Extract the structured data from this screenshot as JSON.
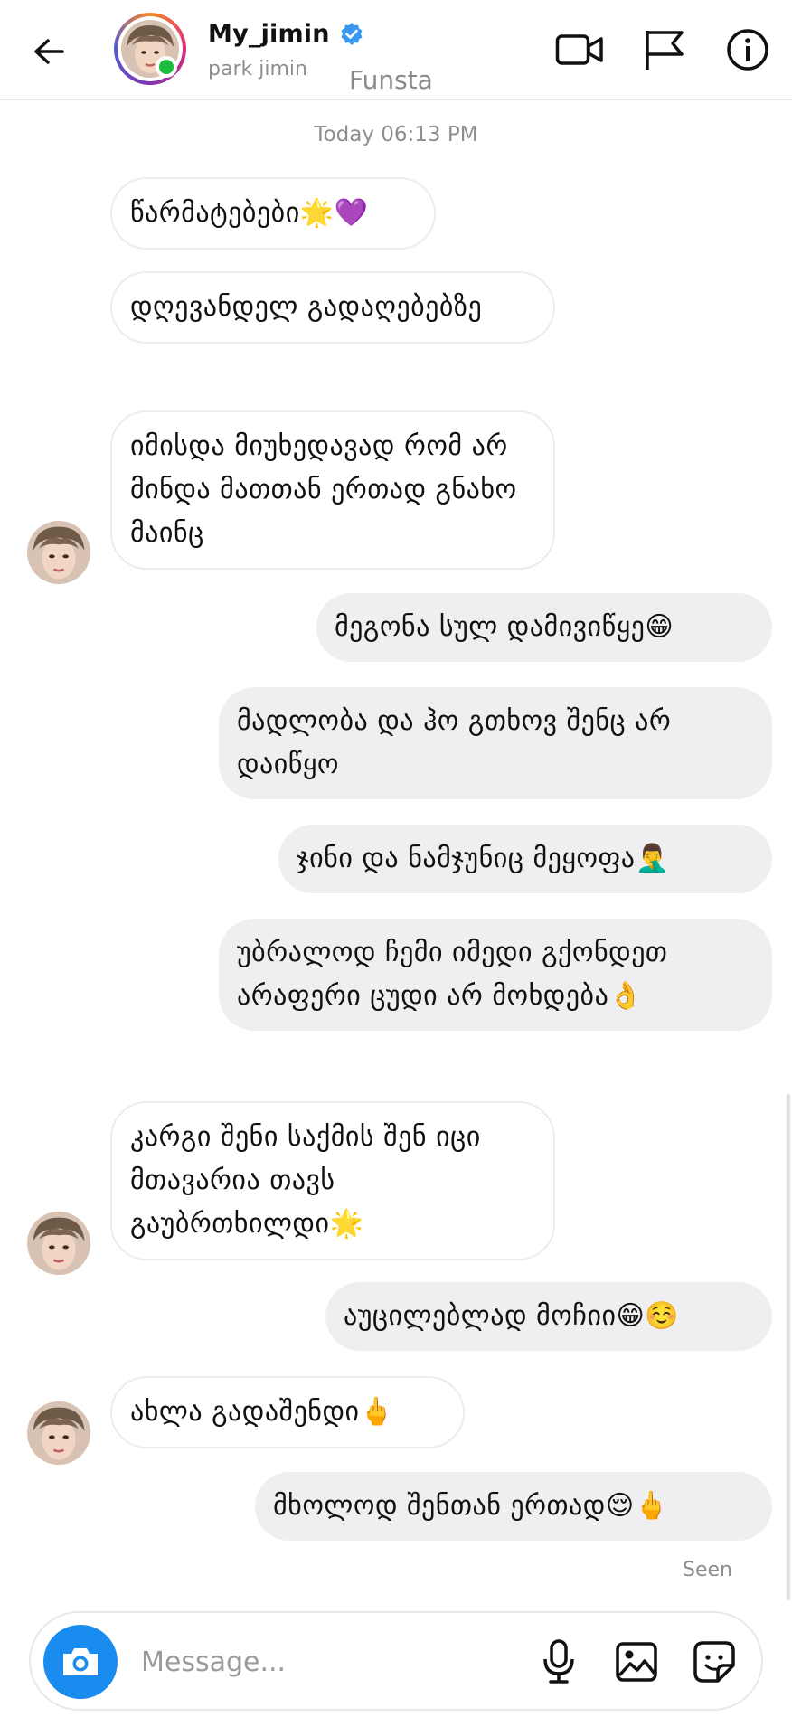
{
  "header": {
    "username": "My_jimin",
    "subname": "park jimin",
    "overlay_text": "Funsta",
    "icons": [
      "back-arrow-icon",
      "verified-badge-icon",
      "video-call-icon",
      "flag-icon",
      "info-icon"
    ]
  },
  "conversation": {
    "timestamp": "Today 06:13 PM",
    "messages": [
      {
        "from": "them",
        "text": "წარმატებები🌟💜"
      },
      {
        "from": "them",
        "text": "დღევანდელ გადაღებებზე"
      },
      {
        "from": "them",
        "text": "იმისდა მიუხედავად რომ არ მინდა მათთან ერთად გნახო მაინც"
      },
      {
        "from": "me",
        "text": "მეგონა სულ დამივიწყე😁"
      },
      {
        "from": "me",
        "text": "მადლობა და ჰო გთხოვ შენც არ დაიწყო"
      },
      {
        "from": "me",
        "text": "ჯინი და ნამჯუნიც მეყოფა🤦‍♂️"
      },
      {
        "from": "me",
        "text": "უბრალოდ ჩემი იმედი გქონდეთ არაფერი ცუდი არ მოხდება👌"
      },
      {
        "from": "them",
        "text": "კარგი შენი საქმის შენ იცი მთავარია თავს გაუბრთხილდი🌟"
      },
      {
        "from": "me",
        "text": "აუცილებლად მოჩიი😁☺️"
      },
      {
        "from": "them",
        "text": "ახლა გადაშენდი🖕"
      },
      {
        "from": "me",
        "text": "მხოლოდ შენთან ერთად😌🖕"
      }
    ],
    "seen_label": "Seen"
  },
  "composer": {
    "placeholder": "Message...",
    "icons": [
      "camera-icon",
      "microphone-icon",
      "gallery-icon",
      "sticker-icon"
    ]
  },
  "colors": {
    "accent_blue": "#1a8cf0",
    "online_green": "#1cbd3d",
    "outgoing_bubble": "#efeff1",
    "muted_text": "#8e8e8e"
  }
}
